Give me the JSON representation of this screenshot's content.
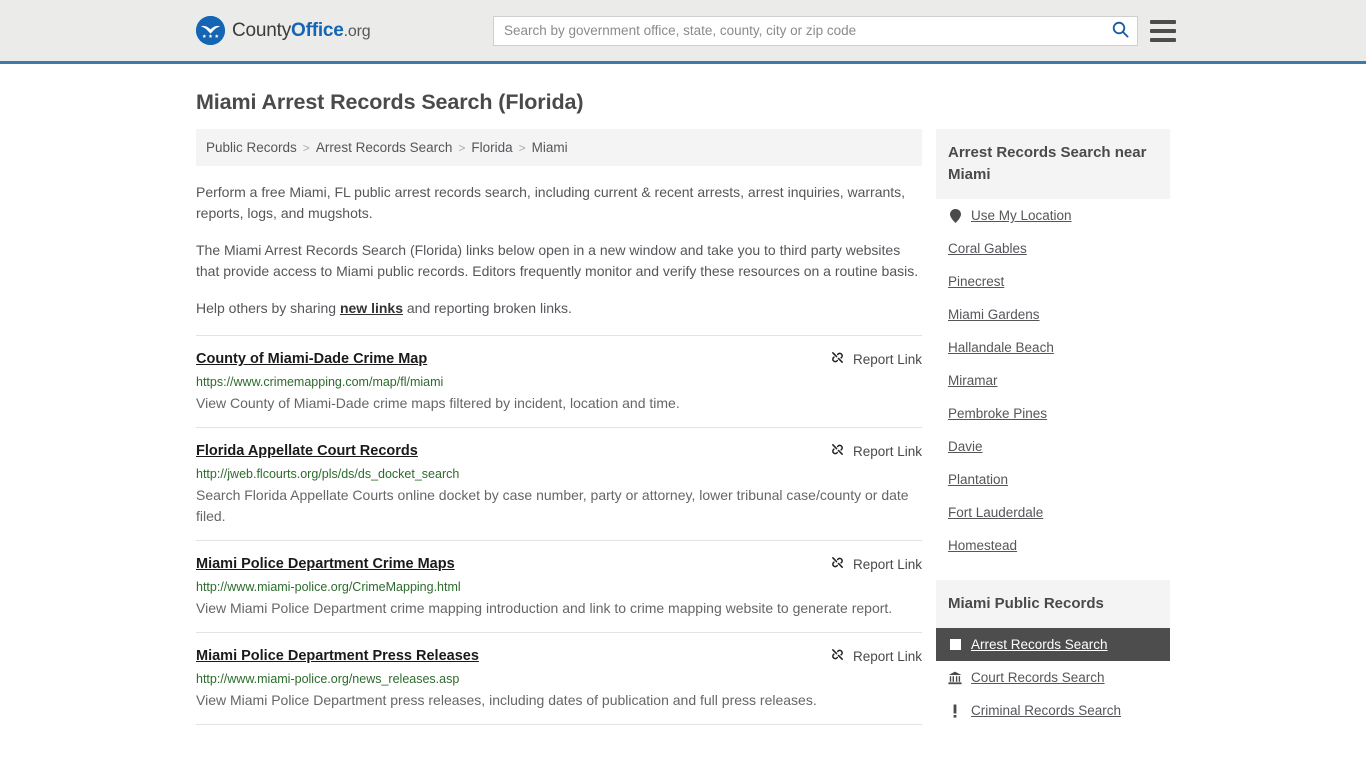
{
  "header": {
    "logo": {
      "part1": "County",
      "part2": "Office",
      "part3": ".org",
      "icon": "eagle-seal-icon"
    },
    "search": {
      "placeholder": "Search by government office, state, county, city or zip code",
      "value": "",
      "button_icon": "search-icon"
    },
    "menu_icon": "hamburger-menu-icon"
  },
  "page": {
    "title": "Miami Arrest Records Search (Florida)"
  },
  "breadcrumb": {
    "items": [
      {
        "label": "Public Records",
        "current": false
      },
      {
        "label": "Arrest Records Search",
        "current": false
      },
      {
        "label": "Florida",
        "current": false
      },
      {
        "label": "Miami",
        "current": true
      }
    ],
    "separator": ">"
  },
  "intro": {
    "p1": "Perform a free Miami, FL public arrest records search, including current & recent arrests, arrest inquiries, warrants, reports, logs, and mugshots.",
    "p2": "The Miami Arrest Records Search (Florida) links below open in a new window and take you to third party websites that provide access to Miami public records. Editors frequently monitor and verify these resources on a routine basis.",
    "p3_before": "Help others by sharing ",
    "p3_link": "new links",
    "p3_after": " and reporting broken links."
  },
  "results": {
    "report_label": "Report Link",
    "report_icon": "broken-link-icon",
    "items": [
      {
        "title": "County of Miami-Dade Crime Map",
        "url": "https://www.crimemapping.com/map/fl/miami",
        "description": "View County of Miami-Dade crime maps filtered by incident, location and time."
      },
      {
        "title": "Florida Appellate Court Records",
        "url": "http://jweb.flcourts.org/pls/ds/ds_docket_search",
        "description": "Search Florida Appellate Courts online docket by case number, party or attorney, lower tribunal case/county or date filed."
      },
      {
        "title": "Miami Police Department Crime Maps",
        "url": "http://www.miami-police.org/CrimeMapping.html",
        "description": "View Miami Police Department crime mapping introduction and link to crime mapping website to generate report."
      },
      {
        "title": "Miami Police Department Press Releases",
        "url": "http://www.miami-police.org/news_releases.asp",
        "description": "View Miami Police Department press releases, including dates of publication and full press releases."
      }
    ]
  },
  "sidebar": {
    "nearby": {
      "title": "Arrest Records Search near Miami",
      "items": [
        {
          "label": "Use My Location",
          "icon": "map-pin-icon"
        },
        {
          "label": "Coral Gables",
          "icon": ""
        },
        {
          "label": "Pinecrest",
          "icon": ""
        },
        {
          "label": "Miami Gardens",
          "icon": ""
        },
        {
          "label": "Hallandale Beach",
          "icon": ""
        },
        {
          "label": "Miramar",
          "icon": ""
        },
        {
          "label": "Pembroke Pines",
          "icon": ""
        },
        {
          "label": "Davie",
          "icon": ""
        },
        {
          "label": "Plantation",
          "icon": ""
        },
        {
          "label": "Fort Lauderdale",
          "icon": ""
        },
        {
          "label": "Homestead",
          "icon": ""
        }
      ]
    },
    "public_records": {
      "title": "Miami Public Records",
      "items": [
        {
          "label": "Arrest Records Search",
          "icon": "square-icon",
          "active": true
        },
        {
          "label": "Court Records Search",
          "icon": "courthouse-icon",
          "active": false
        },
        {
          "label": "Criminal Records Search",
          "icon": "exclamation-icon",
          "active": false
        }
      ]
    }
  },
  "colors": {
    "accent_blue": "#3d79ab",
    "logo_blue": "#1565b5",
    "url_green": "#2c6b2c",
    "active_bg": "#4d4d4d",
    "header_bg": "#ebebea"
  }
}
